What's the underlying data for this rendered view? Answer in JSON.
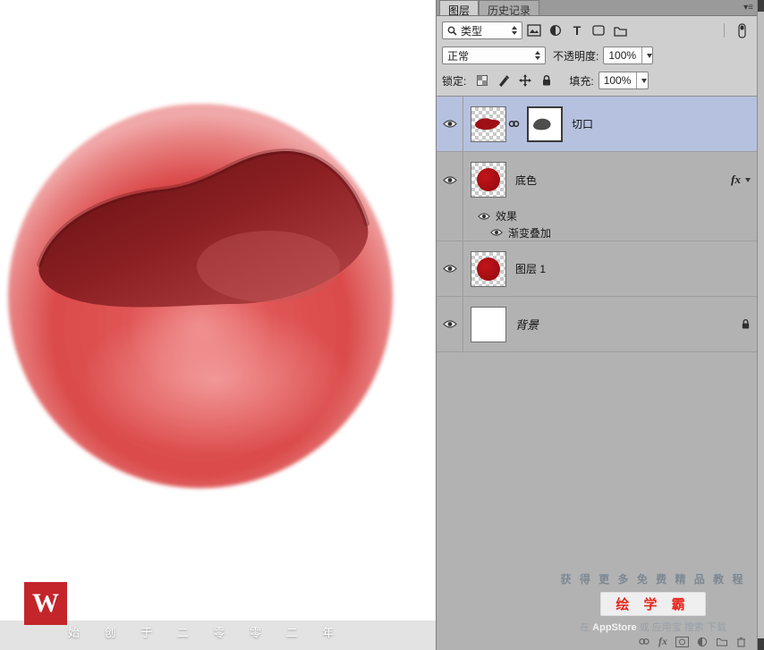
{
  "canvas": {
    "watermark": "始 创 于 二 零 零 二 年",
    "logo": "W"
  },
  "panel": {
    "tabs": {
      "layers": "图层",
      "history": "历史记录"
    },
    "filter_row": {
      "type_label": "类型"
    },
    "blend_row": {
      "blend_mode": "正常",
      "opacity_label": "不透明度:",
      "opacity_value": "100%"
    },
    "lock_row": {
      "lock_label": "锁定:",
      "fill_label": "填充:",
      "fill_value": "100%"
    },
    "layers": [
      {
        "name": "切口"
      },
      {
        "name": "底色",
        "fx_badge": "fx",
        "effects_header": "效果",
        "effect_1": "渐变叠加"
      },
      {
        "name": "图层 1"
      },
      {
        "name": "背景"
      }
    ],
    "ad": {
      "line1": "获 得 更 多 免 费 精 品 教 程",
      "line2": "绘 学 霸",
      "line3_prefix": "在 ",
      "line3_app": "AppStore",
      "line3_rest": " 或 应用宝 搜索 下载"
    }
  },
  "colors": {
    "accent_red": "#c4252b",
    "brand_red": "#e8261c",
    "selected_layer": "#b5c1de",
    "ball_red": "#dd4d4d",
    "cut_dark_red": "#6e1316"
  }
}
